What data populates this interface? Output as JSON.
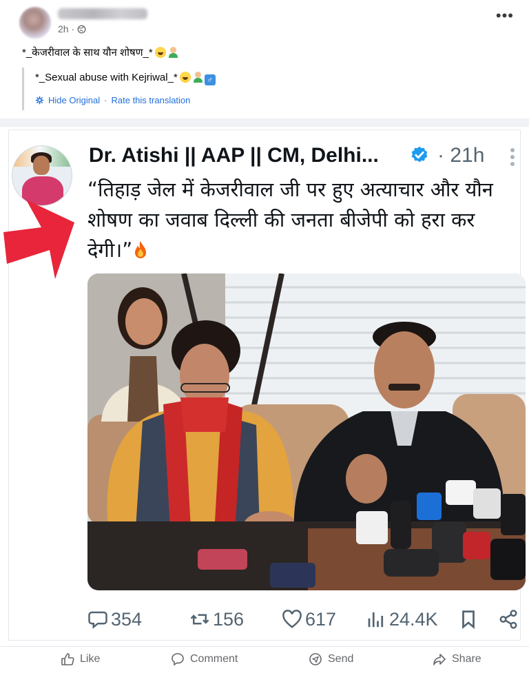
{
  "post": {
    "time": "2h ·",
    "original_text": "*_केजरीवाल के साथ यौन शोषण_*",
    "translated_text": "*_Sexual abuse with Kejriwal_*",
    "hide_original": "Hide Original",
    "separator": "·",
    "rate_translation": "Rate this translation",
    "more_label": "•••"
  },
  "tweet": {
    "name": "Dr. Atishi || AAP || CM, Delhi...",
    "time": "· 21h",
    "text": "“तिहाड़ जेल में केजरीवाल जी पर हुए अत्याचार और यौन शोषण का जवाब दिल्ली की जनता बीजेपी को हरा कर देगी।”",
    "replies": "354",
    "retweets": "156",
    "likes": "617",
    "views": "24.4K"
  },
  "actions": {
    "like": "Like",
    "comment": "Comment",
    "send": "Send",
    "share": "Share"
  },
  "colors": {
    "link_blue": "#216fdb",
    "verified_blue": "#1d9bf0",
    "arrow_red": "#e8253a",
    "muted_gray": "#65676b"
  },
  "icons": [
    "globe-icon",
    "gear-icon",
    "verified-icon",
    "fire-icon",
    "reply-icon",
    "retweet-icon",
    "heart-icon",
    "views-icon",
    "bookmark-icon",
    "share-icon",
    "like-icon",
    "comment-icon",
    "send-icon"
  ]
}
